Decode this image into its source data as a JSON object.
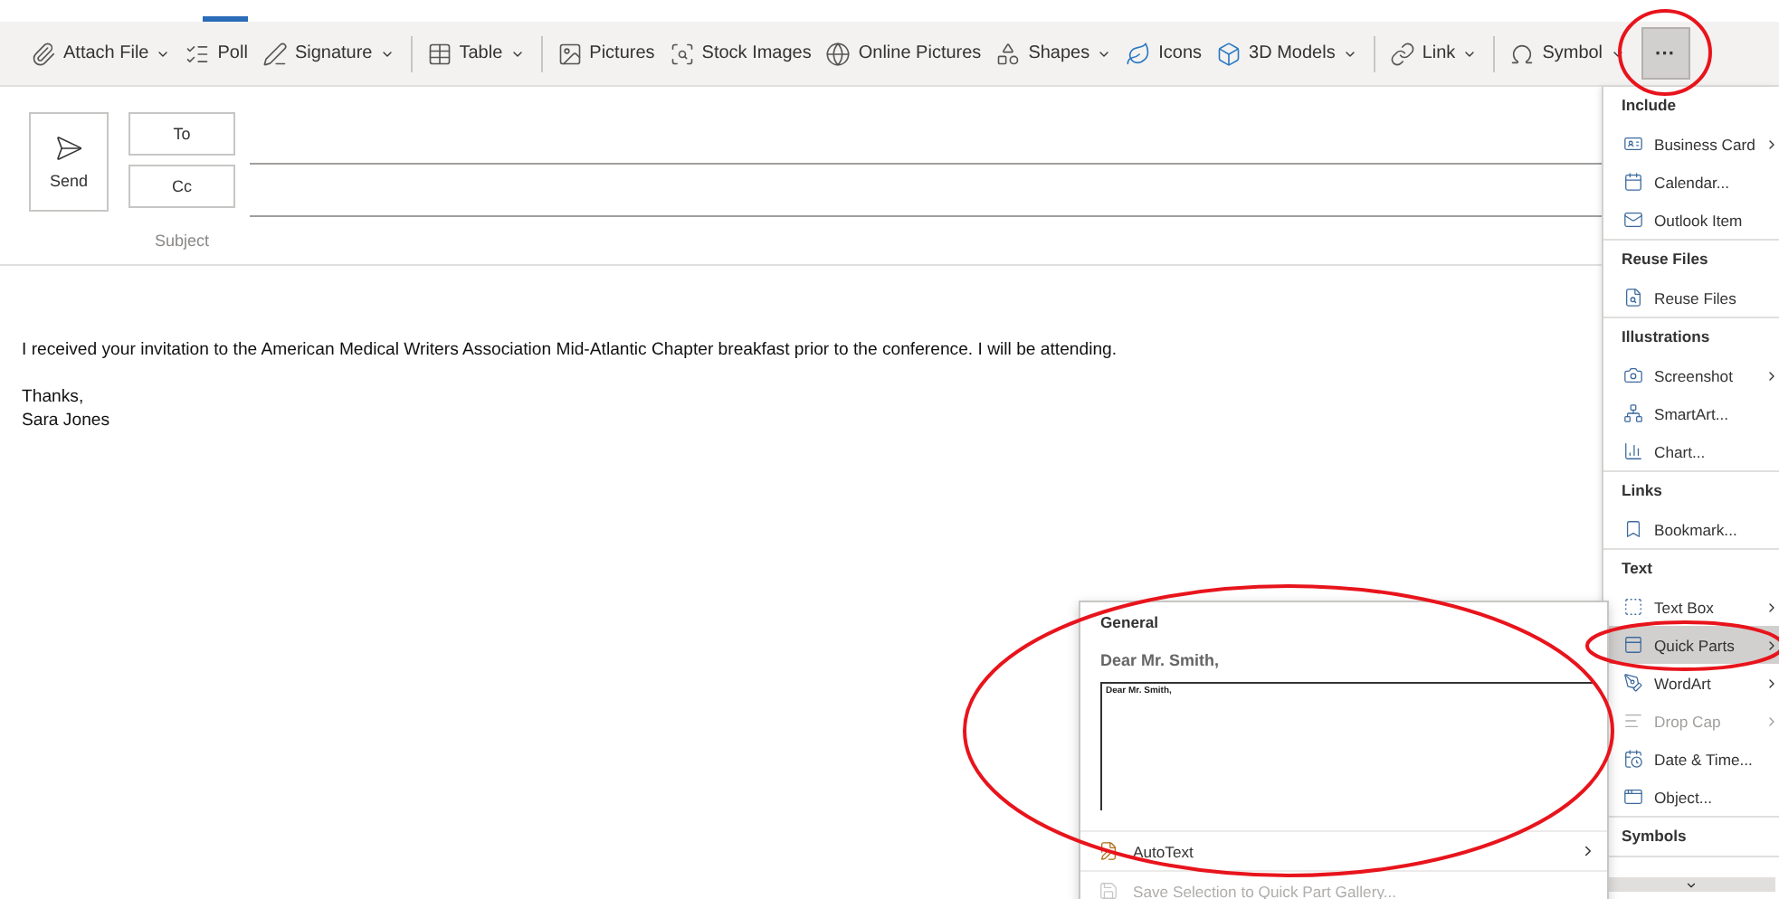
{
  "toolbar": {
    "items": [
      {
        "label": "Attach File",
        "dropdown": true,
        "group_start": false
      },
      {
        "label": "Poll",
        "dropdown": false,
        "group_start": false
      },
      {
        "label": "Signature",
        "dropdown": true,
        "group_start": false
      },
      {
        "label": "Table",
        "dropdown": true,
        "group_start": true
      },
      {
        "label": "Pictures",
        "dropdown": false,
        "group_start": true
      },
      {
        "label": "Stock Images",
        "dropdown": false,
        "group_start": false
      },
      {
        "label": "Online Pictures",
        "dropdown": false,
        "group_start": false
      },
      {
        "label": "Shapes",
        "dropdown": true,
        "group_start": false
      },
      {
        "label": "Icons",
        "dropdown": false,
        "group_start": false
      },
      {
        "label": "3D Models",
        "dropdown": true,
        "group_start": false
      },
      {
        "label": "Link",
        "dropdown": true,
        "group_start": true
      },
      {
        "label": "Symbol",
        "dropdown": true,
        "group_start": true
      }
    ],
    "more_button": {
      "label": "···",
      "selected": true
    }
  },
  "compose": {
    "send": "Send",
    "to": "To",
    "cc": "Cc",
    "subject_label": "Subject"
  },
  "body": {
    "paragraphs": [
      [
        "I received your invitation to the American Medical Writers Association Mid-Atlantic Chapter breakfast prior to the conference. I will be attending."
      ],
      [
        "Thanks,",
        "Sara Jones"
      ]
    ]
  },
  "insert_menu": {
    "sections": [
      {
        "header": "Include",
        "items": [
          {
            "label": "Business Card",
            "submenu": true,
            "disabled": false,
            "selected": false
          },
          {
            "label": "Calendar...",
            "submenu": false,
            "disabled": false,
            "selected": false
          },
          {
            "label": "Outlook Item",
            "submenu": false,
            "disabled": false,
            "selected": false
          }
        ]
      },
      {
        "header": "Reuse Files",
        "items": [
          {
            "label": "Reuse Files",
            "submenu": false,
            "disabled": false,
            "selected": false
          }
        ]
      },
      {
        "header": "Illustrations",
        "items": [
          {
            "label": "Screenshot",
            "submenu": true,
            "disabled": false,
            "selected": false
          },
          {
            "label": "SmartArt...",
            "submenu": false,
            "disabled": false,
            "selected": false
          },
          {
            "label": "Chart...",
            "submenu": false,
            "disabled": false,
            "selected": false
          }
        ]
      },
      {
        "header": "Links",
        "items": [
          {
            "label": "Bookmark...",
            "submenu": false,
            "disabled": false,
            "selected": false
          }
        ]
      },
      {
        "header": "Text",
        "items": [
          {
            "label": "Text Box",
            "submenu": true,
            "disabled": false,
            "selected": false
          },
          {
            "label": "Quick Parts",
            "submenu": true,
            "disabled": false,
            "selected": true
          },
          {
            "label": "WordArt",
            "submenu": true,
            "disabled": false,
            "selected": false
          },
          {
            "label": "Drop Cap",
            "submenu": true,
            "disabled": true,
            "selected": false
          },
          {
            "label": "Date & Time...",
            "submenu": false,
            "disabled": false,
            "selected": false
          },
          {
            "label": "Object...",
            "submenu": false,
            "disabled": false,
            "selected": false
          }
        ]
      },
      {
        "header": "Symbols"
      }
    ]
  },
  "quick_parts": {
    "section": "General",
    "entry_title": "Dear Mr. Smith,",
    "preview_text": "Dear Mr. Smith,",
    "items": [
      {
        "label": "AutoText",
        "submenu": true,
        "disabled": false
      },
      {
        "label": "Save Selection to Quick Part Gallery...",
        "submenu": false,
        "disabled": true
      }
    ]
  }
}
